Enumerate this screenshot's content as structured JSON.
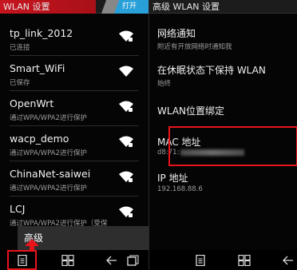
{
  "left": {
    "title": "WLAN 设置",
    "toggle_label": "打开",
    "networks": [
      {
        "name": "tp_link_2012",
        "status": "已连接"
      },
      {
        "name": "Smart_WiFi",
        "status": "已保存"
      },
      {
        "name": "OpenWrt",
        "status": "通过WPA/WPA2进行保护"
      },
      {
        "name": "wacp_demo",
        "status": "通过WPA/WPA2进行保护"
      },
      {
        "name": "ChinaNet-saiwei",
        "status": "通过WPA/WPA2进行保护"
      },
      {
        "name": "LCJ",
        "status": "通过WPA/WPA2进行保护（受保"
      }
    ],
    "menu_item": "高级"
  },
  "right": {
    "title": "高级 WLAN 设置",
    "settings": [
      {
        "title": "网络通知",
        "sub": "附近有开放网络时通知我"
      },
      {
        "title": "在休眠状态下保持 WLAN",
        "sub": "始终"
      },
      {
        "title": "WLAN位置绑定",
        "sub": ""
      },
      {
        "title": "MAC 地址",
        "sub": "d8:71:"
      },
      {
        "title": "IP 地址",
        "sub": "192.168.88.6"
      }
    ]
  },
  "icons": [
    "wifi-signal-icon",
    "menu-icon",
    "home-icon",
    "back-icon",
    "recents-icon"
  ],
  "colors": {
    "highlight": "#e8141c",
    "titlebar_red": "#c7151f",
    "switch_blue": "#2aa0d8"
  }
}
